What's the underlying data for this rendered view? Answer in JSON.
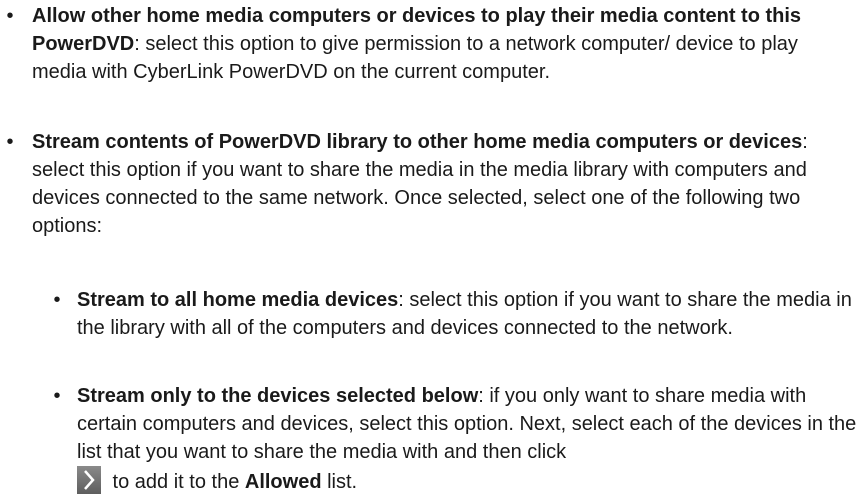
{
  "items": [
    {
      "bold": "Allow other home media computers or devices to play their media content to this PowerDVD",
      "text": ": select this option to give permission to a network computer/ device to play media with CyberLink PowerDVD on the current computer."
    },
    {
      "bold": "Stream contents of PowerDVD library to other home media computers or devices",
      "text": ": select this option if you want to share the media in the media library with computers and devices connected to the same network. Once selected, select one of the following two options:"
    },
    {
      "bold": "Stream to all home media devices",
      "text": ": select this option if you want to share the media in the library with all of the computers and devices connected to the network."
    },
    {
      "bold": "Stream only to the devices selected below",
      "text": ": if you only want to share media with certain computers and devices, select this option. Next, select each of the devices in the list that you want to share the media with and then click",
      "after_icon": " to add it to the ",
      "allowed": "Allowed",
      "end": " list."
    }
  ],
  "bullet": "•",
  "icon": "chevron-right-icon"
}
